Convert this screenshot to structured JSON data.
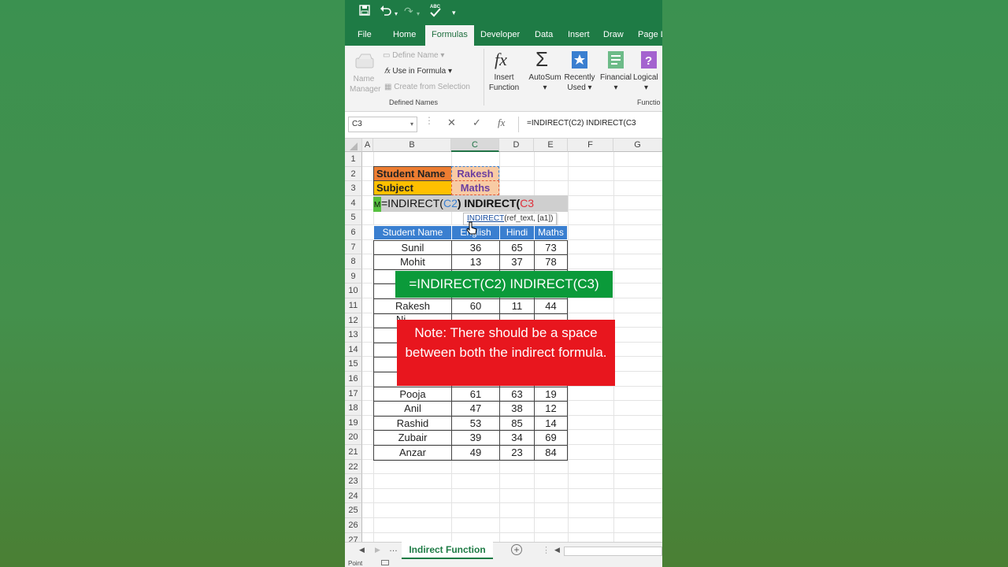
{
  "qat": {
    "redo": "↷"
  },
  "ribbon_tabs": [
    "File",
    "Home",
    "Formulas",
    "Developer",
    "Data",
    "Insert",
    "Draw",
    "Page L"
  ],
  "defined_names": {
    "name_manager_1": "Name",
    "name_manager_2": "Manager",
    "define_name": "Define Name",
    "use_in_formula": "Use in Formula",
    "create_from_selection": "Create from Selection",
    "group_label": "Defined Names"
  },
  "function_library": {
    "insert_function_1": "Insert",
    "insert_function_2": "Function",
    "autosum": "AutoSum",
    "recently_used_1": "Recently",
    "recently_used_2": "Used",
    "financial": "Financial",
    "logical": "Logical",
    "group_label": "Functio"
  },
  "formula_bar": {
    "name_box": "C3",
    "formula": "=INDIRECT(C2) INDIRECT(C3"
  },
  "columns": [
    "A",
    "B",
    "C",
    "D",
    "E",
    "F",
    "G"
  ],
  "rows": [
    "1",
    "2",
    "3",
    "4",
    "5",
    "6",
    "7",
    "8",
    "9",
    "10",
    "11",
    "12",
    "13",
    "14",
    "15",
    "16",
    "17",
    "18",
    "19",
    "20",
    "21",
    "22",
    "23",
    "24",
    "25",
    "26",
    "27"
  ],
  "lookup": {
    "label_name": "Student Name",
    "value_name": "Rakesh",
    "label_subject": "Subject",
    "value_subject": "Maths"
  },
  "edit_cell": {
    "prefix": "=INDIRECT(",
    "ref1": "C2",
    "mid": ") INDIRECT(",
    "ref2": "C3",
    "indicator": "M"
  },
  "tooltip": {
    "fn": "INDIRECT",
    "args": "(ref_text, [a1])"
  },
  "table": {
    "headers": [
      "Student Name",
      "English",
      "Hindi",
      "Maths"
    ],
    "rows": [
      [
        "Sunil",
        "36",
        "65",
        "73"
      ],
      [
        "Mohit",
        "13",
        "37",
        "78"
      ],
      [
        "Rakesh",
        "60",
        "11",
        "44"
      ],
      [
        "Pooja",
        "61",
        "63",
        "19"
      ],
      [
        "Anil",
        "47",
        "38",
        "12"
      ],
      [
        "Rashid",
        "53",
        "85",
        "14"
      ],
      [
        "Zubair",
        "39",
        "34",
        "69"
      ],
      [
        "Anzar",
        "49",
        "23",
        "84"
      ]
    ],
    "partial_row12": "Ni"
  },
  "banner": "=INDIRECT(C2) INDIRECT(C3)",
  "note": "Note: There should be a space between both the indirect formula.",
  "sheet_tab": "Indirect Function",
  "status": "Point",
  "colors": {
    "excel_green": "#1e7b45",
    "header_blue": "#3a7fd0",
    "label_orange": "#ed7d31",
    "label_yellow": "#ffc000",
    "value_peach": "#f8cba4",
    "banner_green": "#0b9a3a",
    "note_red": "#e8161e"
  }
}
